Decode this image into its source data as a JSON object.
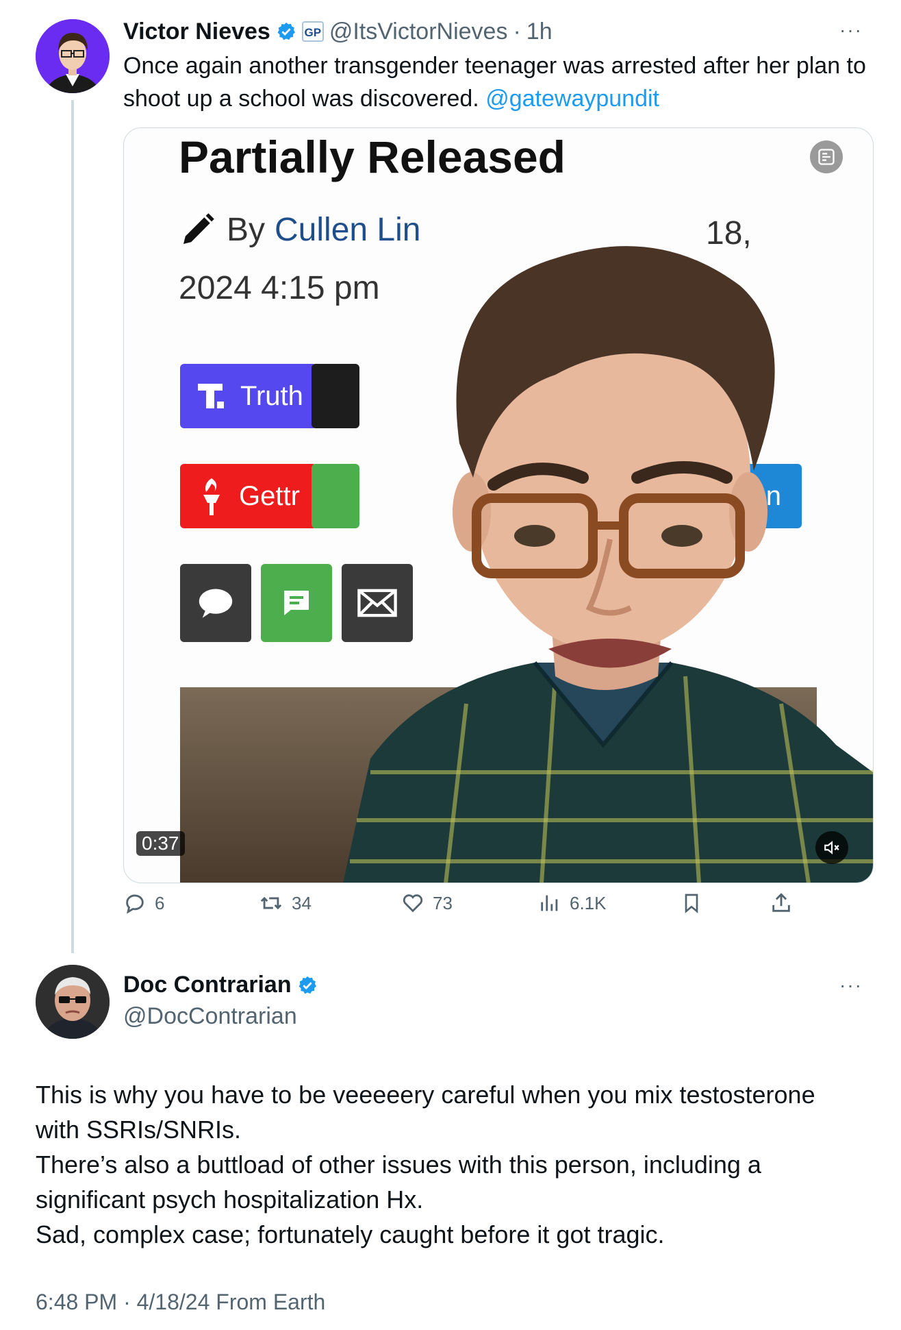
{
  "tweet": {
    "author_name": "Victor Nieves",
    "affiliate_badge": "GP",
    "handle": "@ItsVictorNieves",
    "separator": "·",
    "time": "1h",
    "more": "···",
    "text_line1": "Once again another transgender teenager was arrested after her plan to",
    "text_line2": "shoot up a school was discovered.",
    "mention": "@gatewaypundit",
    "video": {
      "article_title": "Partially Released",
      "by": "By",
      "author": "Cullen Lin",
      "date_tail": "18,",
      "date_line2": "2024 4:15 pm",
      "truth_label": "Truth",
      "gettr_label": "Gettr",
      "partial_label": "n",
      "duration": "0:37"
    },
    "actions": {
      "replies": "6",
      "reposts": "34",
      "likes": "73",
      "views": "6.1K"
    }
  },
  "reply": {
    "author_name": "Doc Contrarian",
    "handle": "@DocContrarian",
    "more": "···",
    "lines": [
      "This is why you have to be veeeeery careful when you mix testosterone",
      "with SSRIs/SNRIs.",
      "There’s also a buttload of other issues with this person, including a",
      "significant psych hospitalization Hx.",
      "Sad, complex case; fortunately caught before it got tragic."
    ],
    "timestamp": "6:48 PM · 4/18/24 From Earth"
  },
  "colors": {
    "verified": "#1d9bf0",
    "truth": "#5448ee",
    "gettr": "#ee1c1c",
    "sms": "#4cae4c",
    "dark_btn": "#3a3a3a",
    "link": "#1d9bf0"
  }
}
